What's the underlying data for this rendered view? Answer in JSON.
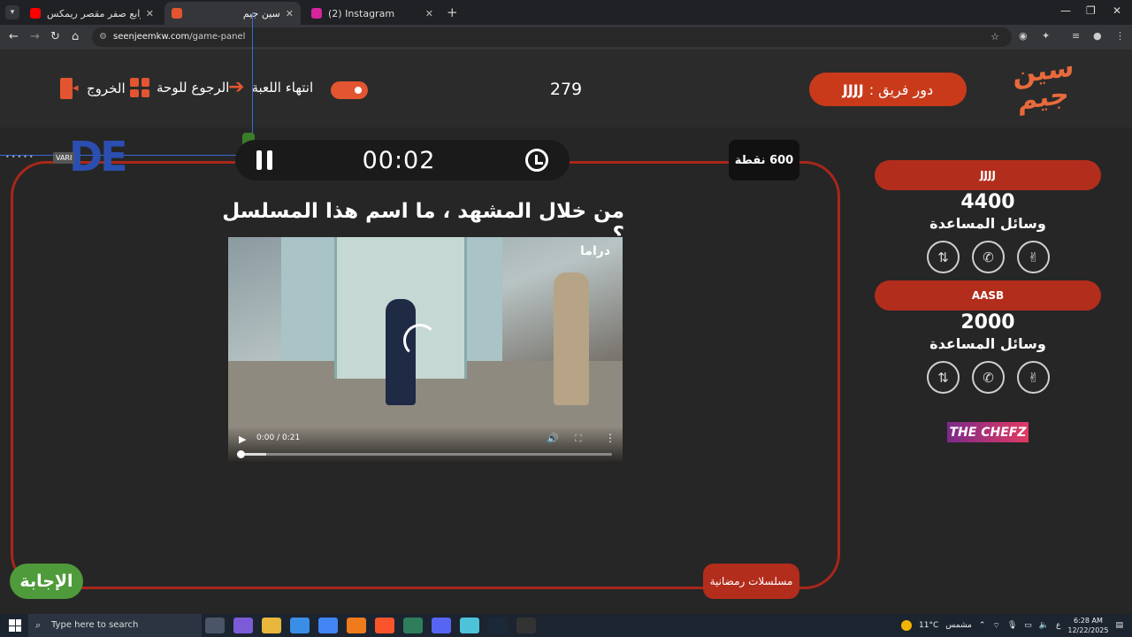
{
  "browser": {
    "tabs": [
      {
        "title": "رابع صفر مقصر ريمكس | YouTube",
        "active": false,
        "favicon_color": "#ff0000"
      },
      {
        "title": "سين جيم",
        "active": true,
        "favicon_color": "#e25530"
      },
      {
        "title": "(2) Instagram",
        "active": false,
        "favicon_color": "#d6249f"
      }
    ],
    "url_host": "seenjeemkw.com",
    "url_path": "/game-panel"
  },
  "header": {
    "exit_label": "الخروج",
    "back_to_board_label": "الرجوع للوحة",
    "end_game_label": "انتهاء اللعبة",
    "counter": "279",
    "turn_prefix": "دور فريق :",
    "turn_team": "JJJJ",
    "logo_line1": "سين",
    "logo_line2": "جيم"
  },
  "question": {
    "timer": "00:02",
    "points": "600 نقطة",
    "text": "من خلال المشهد ، ما اسم هذا المسلسل ؟",
    "video": {
      "channel_logo": "دراما",
      "time_display": "0:00 / 0:21",
      "progress": 0.0,
      "buffered": 0.07
    },
    "answer_label": "الإجابة",
    "category": "مسلسلات رمضانية"
  },
  "overlay": {
    "tag": "VARI"
  },
  "teams": [
    {
      "name": "JJJJ",
      "score": "4400",
      "help_label": "وسائل المساعدة"
    },
    {
      "name": "AASB",
      "score": "2000",
      "help_label": "وسائل المساعدة"
    }
  ],
  "sponsor": "THE CHEFZ",
  "taskbar": {
    "search_placeholder": "Type here to search",
    "weather": "11°C",
    "weather_text": "مشمس",
    "lang": "ع",
    "time": "6:28 AM",
    "date": "12/22/2025"
  },
  "colors": {
    "accent": "#e25530",
    "team_pill": "#b32d1c",
    "answer": "#4f9a3b",
    "frame": "#a8271a"
  }
}
